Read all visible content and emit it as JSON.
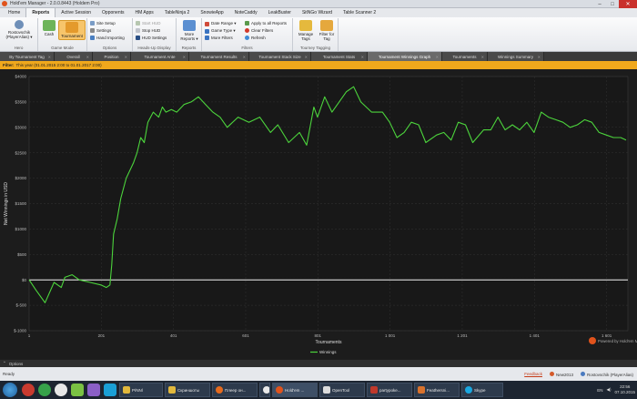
{
  "window": {
    "title": "Hold'em Manager - 2.0.0.8443 (Holdem Pro)",
    "buttons": [
      "–",
      "□",
      "✕"
    ]
  },
  "menu_tabs": [
    "Home",
    "Reports",
    "Active Session",
    "Opponents",
    "HM Apps",
    "TableNinja 2",
    "SnowieApp",
    "NoteCaddy",
    "LeakBuster",
    "SitNGo Wizard",
    "Table Scanner 2"
  ],
  "ribbon": {
    "hero": {
      "name": "Rostovschik (PlayerAlias) ▾",
      "label": "Hero"
    },
    "game_mode": {
      "cash": "Cash",
      "tournament": "Tournament",
      "label": "Game Mode"
    },
    "options": {
      "site_setup": "Site Setup",
      "settings": "Settings",
      "hand_importing": "Hand Importing",
      "label": "Options"
    },
    "hud": {
      "start": "Start HUD",
      "stop": "Stop HUD",
      "settings": "HUD Settings",
      "label": "Heads-Up Display"
    },
    "reports": {
      "more": "More Reports ▾",
      "label": "Reports"
    },
    "filters": {
      "date_range": "Date Range ▾",
      "game_type": "Game Type ▾",
      "more_filters": "More Filters",
      "apply_all": "Apply to all Reports",
      "clear": "Clear Filters",
      "refresh": "Refresh",
      "label": "Filters"
    },
    "tagging": {
      "manage": "Manage Tags",
      "filter": "Filter for Tag",
      "label": "Tourney Tagging"
    }
  },
  "view_tabs": [
    "By Tournament Tag",
    "Overall",
    "Position",
    "Tournament Ante",
    "Tournament Results",
    "Tournament Stack Size",
    "Tournament Stats",
    "Tournament Winnings Graph",
    "Tournaments",
    "Winnings Summary"
  ],
  "active_view_tab": "Tournament Winnings Graph",
  "filter_bar": {
    "label": "Filter:",
    "value": "This year (01.01.2015 2:00 to 01.01.2017 2:00)"
  },
  "chart_data": {
    "type": "line",
    "xlabel": "Tournaments",
    "ylabel": "Net Winnings in USD",
    "x_ticks": [
      "1",
      "201",
      "401",
      "601",
      "801",
      "1 001",
      "1 201",
      "1 401",
      "1 601"
    ],
    "y_ticks": [
      "$4000",
      "$3500",
      "$3000",
      "$2500",
      "$2000",
      "$1500",
      "$1000",
      "$500",
      "$0",
      "$-500",
      "$-1000"
    ],
    "xlim": [
      1,
      1660
    ],
    "ylim": [
      -1000,
      4000
    ],
    "grid": true,
    "legend_position": "bottom-center",
    "watermark": "Powered by Hold'em Manager",
    "series": [
      {
        "name": "Winnings",
        "color": "#4cd43c",
        "x": [
          1,
          20,
          45,
          70,
          90,
          100,
          120,
          140,
          170,
          200,
          215,
          225,
          230,
          235,
          245,
          255,
          270,
          290,
          300,
          310,
          320,
          330,
          345,
          360,
          370,
          380,
          395,
          410,
          430,
          450,
          470,
          490,
          510,
          530,
          550,
          580,
          610,
          640,
          670,
          690,
          720,
          750,
          770,
          790,
          800,
          820,
          840,
          860,
          880,
          900,
          920,
          950,
          980,
          1000,
          1020,
          1040,
          1060,
          1080,
          1100,
          1130,
          1150,
          1170,
          1190,
          1210,
          1230,
          1260,
          1280,
          1300,
          1320,
          1340,
          1360,
          1380,
          1400,
          1420,
          1440,
          1460,
          1480,
          1500,
          1520,
          1540,
          1560,
          1580,
          1600,
          1620,
          1640,
          1655
        ],
        "y": [
          0,
          -200,
          -450,
          -50,
          -150,
          50,
          100,
          0,
          -50,
          -100,
          -150,
          -100,
          300,
          900,
          1200,
          1600,
          2000,
          2300,
          2500,
          2800,
          2700,
          3100,
          3300,
          3200,
          3400,
          3300,
          3350,
          3300,
          3450,
          3500,
          3600,
          3450,
          3300,
          3200,
          3000,
          3200,
          3100,
          3200,
          2900,
          3050,
          2700,
          2900,
          2650,
          3400,
          3200,
          3600,
          3300,
          3500,
          3700,
          3800,
          3500,
          3300,
          3300,
          3100,
          2800,
          2900,
          3100,
          3050,
          2700,
          2850,
          2900,
          2750,
          3100,
          3050,
          2700,
          2950,
          2950,
          3200,
          2950,
          3050,
          2950,
          3100,
          2900,
          3300,
          3200,
          3150,
          3100,
          3000,
          3050,
          3150,
          3100,
          2900,
          2850,
          2800,
          2800,
          2750
        ]
      }
    ]
  },
  "options_bar": {
    "label": "Options"
  },
  "status": {
    "ready": "Ready",
    "feedback": "Feedback",
    "db": "New2013",
    "alias": "Rostovschik (PlayerAlias)"
  },
  "taskbar": {
    "apps": [
      "P/NNl",
      "Скриншоты",
      "Плеер он...",
      "Hold'em ...",
      "OpenTool",
      "partypoke...",
      "Feathersni...",
      "Skype"
    ],
    "lang": "EN",
    "time": "22:56",
    "date": "07.10.2015"
  }
}
